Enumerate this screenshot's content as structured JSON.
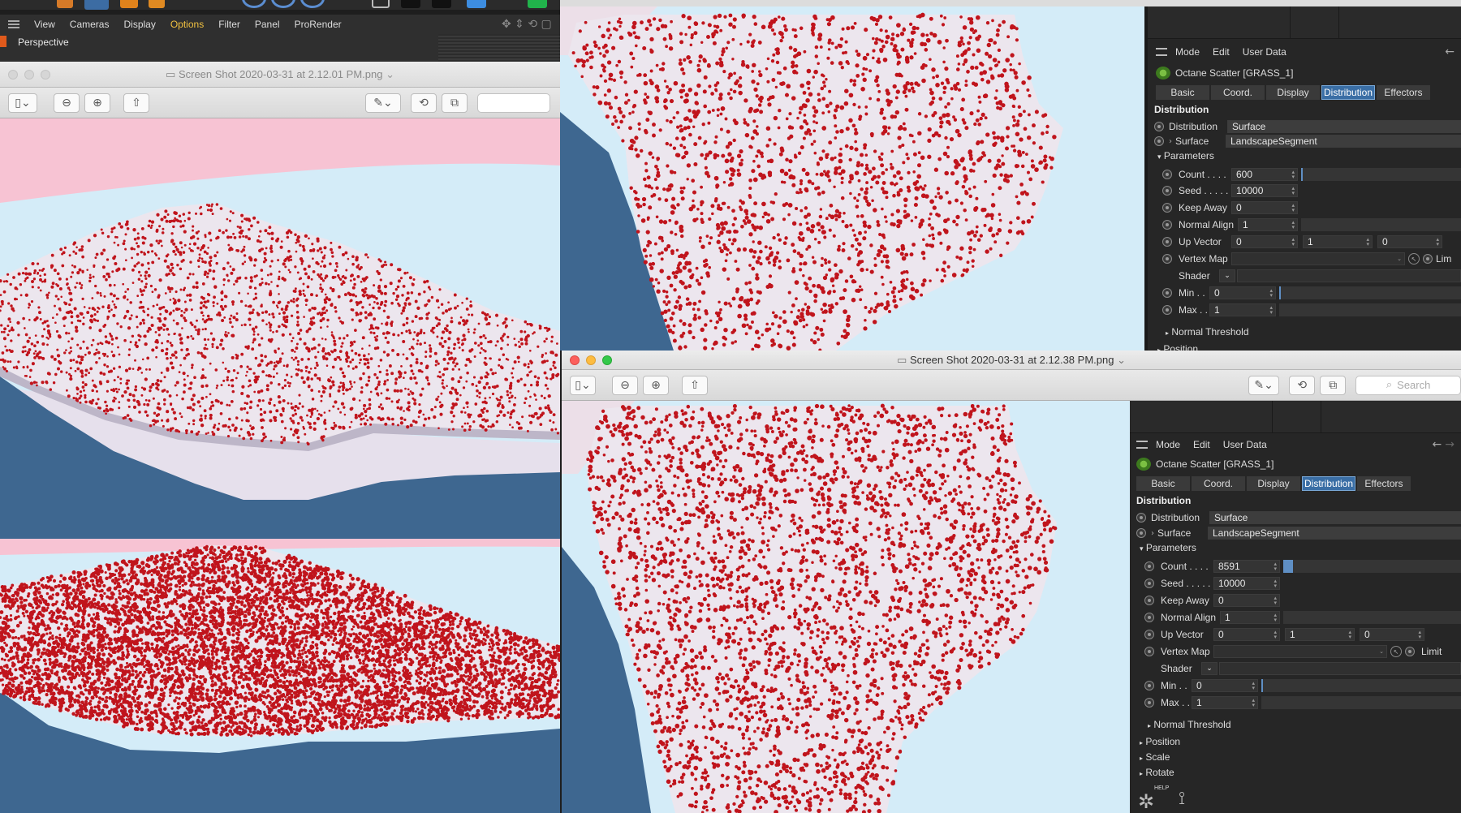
{
  "c4d_menu": {
    "items": [
      "View",
      "Cameras",
      "Display",
      "Options",
      "Filter",
      "Panel",
      "ProRender"
    ],
    "active": "Options",
    "viewport_label": "Perspective"
  },
  "preview_left": {
    "title": "Screen Shot 2020-03-31 at 2.12.01 PM.png",
    "title_chevron": "⌄"
  },
  "preview_right": {
    "title": "Screen Shot 2020-03-31 at 2.12.38 PM.png",
    "title_chevron": "⌄",
    "search_placeholder": "Search"
  },
  "panel_top": {
    "menu": [
      "Mode",
      "Edit",
      "User Data"
    ],
    "object_name": "Octane Scatter [GRASS_1]",
    "tabs": [
      "Basic",
      "Coord.",
      "Display",
      "Distribution",
      "Effectors"
    ],
    "active_tab": "Distribution",
    "section_title": "Distribution",
    "distribution_label": "Distribution",
    "distribution_value": "Surface",
    "surface_label": "Surface",
    "surface_value": "LandscapeSegment",
    "parameters_label": "Parameters",
    "count_label": "Count . . . .",
    "count_value": "600",
    "count_fraction": 0.0,
    "seed_label": "Seed . . . . .",
    "seed_value": "10000",
    "keepaway_label": "Keep Away",
    "keepaway_value": "0",
    "normalalign_label": "Normal Align",
    "normalalign_value": "1",
    "upvector_label": "Up Vector",
    "upvector_x": "0",
    "upvector_y": "1",
    "upvector_z": "0",
    "vertexmap_label": "Vertex Map",
    "limit_label": "Lim",
    "shader_label": "Shader",
    "min_label": "Min . .",
    "min_value": "0",
    "max_label": "Max . .",
    "max_value": "1",
    "normal_threshold_label": "Normal Threshold",
    "position_label": "Position"
  },
  "panel_bottom": {
    "menu": [
      "Mode",
      "Edit",
      "User Data"
    ],
    "object_name": "Octane Scatter [GRASS_1]",
    "tabs": [
      "Basic",
      "Coord.",
      "Display",
      "Distribution",
      "Effectors"
    ],
    "active_tab": "Distribution",
    "section_title": "Distribution",
    "distribution_label": "Distribution",
    "distribution_value": "Surface",
    "surface_label": "Surface",
    "surface_value": "LandscapeSegment",
    "parameters_label": "Parameters",
    "count_label": "Count . . . .",
    "count_value": "8591",
    "count_fraction": 0.04,
    "seed_label": "Seed . . . . .",
    "seed_value": "10000",
    "keepaway_label": "Keep Away",
    "keepaway_value": "0",
    "normalalign_label": "Normal Align",
    "normalalign_value": "1",
    "upvector_label": "Up Vector",
    "upvector_x": "0",
    "upvector_y": "1",
    "upvector_z": "0",
    "vertexmap_label": "Vertex Map",
    "limit_label": "Limit",
    "shader_label": "Shader",
    "min_label": "Min . .",
    "min_value": "0",
    "max_label": "Max . .",
    "max_value": "1",
    "normal_threshold_label": "Normal Threshold",
    "fold_position": "Position",
    "fold_scale": "Scale",
    "fold_rotate": "Rotate",
    "help_label": "HELP"
  },
  "colors": {
    "scatter_dot": "#c0141c",
    "sky": "#d4ecf8",
    "pink": "#f7c3d3",
    "terrain": "#ece6ee",
    "shadow": "#3e6790",
    "active_tab": "#3a6ea5"
  }
}
